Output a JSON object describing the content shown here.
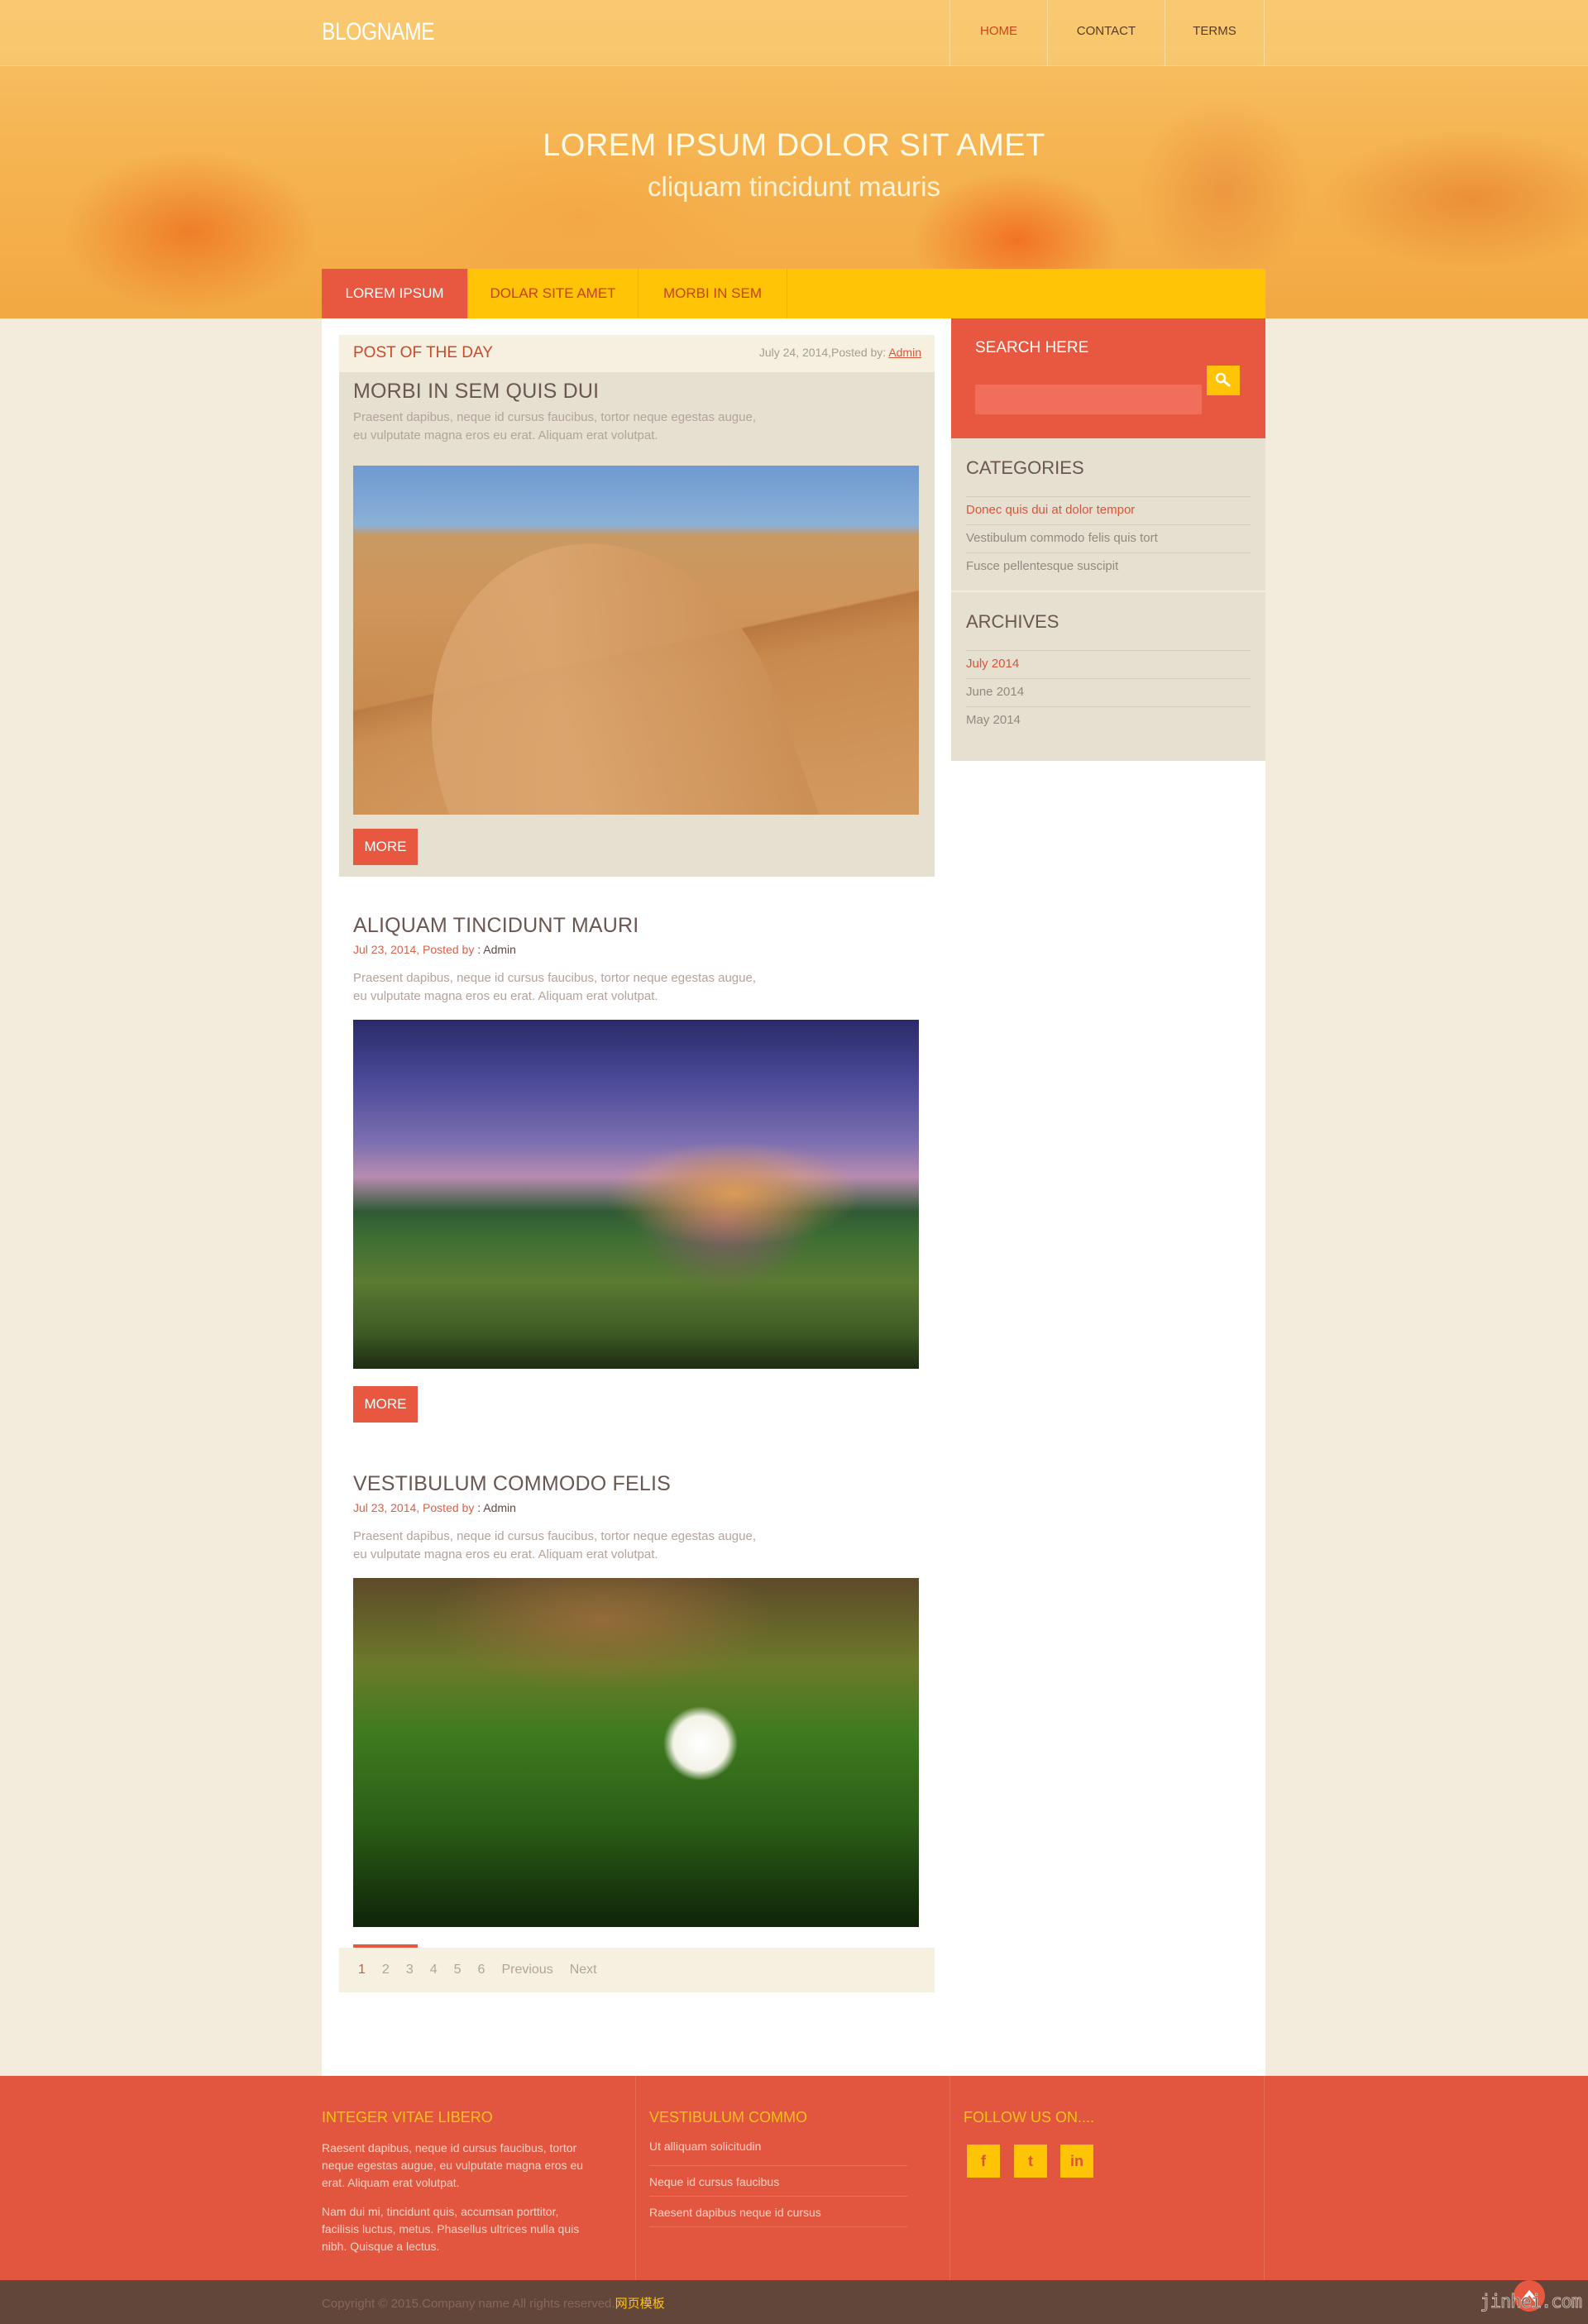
{
  "header": {
    "logo": "BLOGNAME",
    "nav": [
      {
        "label": "HOME",
        "active": true
      },
      {
        "label": "CONTACT",
        "active": false
      },
      {
        "label": "TERMS",
        "active": false
      }
    ]
  },
  "hero": {
    "title": "LOREM IPSUM DOLOR SIT AMET",
    "subtitle": "cliquam tincidunt mauris"
  },
  "subnav": [
    {
      "label": "LOREM IPSUM",
      "active": true
    },
    {
      "label": "DOLAR SITE AMET",
      "active": false
    },
    {
      "label": "MORBI IN SEM",
      "active": false
    }
  ],
  "featured": {
    "label": "POST OF THE DAY",
    "meta_prefix": "July 24, 2014,Posted by: ",
    "author": "Admin",
    "title": "MORBI IN SEM QUIS DUI",
    "excerpt_line1": "Praesent dapibus, neque id cursus faucibus, tortor neque egestas augue,",
    "excerpt_line2": "eu vulputate magna eros eu erat. Aliquam erat volutpat.",
    "image": "desert-dunes-image",
    "more_label": "MORE"
  },
  "posts": [
    {
      "title": "ALIQUAM TINCIDUNT MAURI",
      "meta_prefix": "Jul 23, 2014, Posted by",
      "meta_sep": " : ",
      "author": "Admin",
      "excerpt_line1": "Praesent dapibus, neque id cursus faucibus, tortor neque egestas augue,",
      "excerpt_line2": "eu vulputate magna eros eu erat. Aliquam erat volutpat.",
      "image": "mountain-meadow-image",
      "more_label": "MORE"
    },
    {
      "title": "VESTIBULUM COMMODO FELIS",
      "meta_prefix": "Jul 23, 2014, Posted by",
      "meta_sep": " : ",
      "author": "Admin",
      "excerpt_line1": "Praesent dapibus, neque id cursus faucibus, tortor neque egestas augue,",
      "excerpt_line2": "eu vulputate magna eros eu erat. Aliquam erat volutpat.",
      "image": "white-flower-image",
      "more_label": "MORE"
    }
  ],
  "pagination": {
    "pages": [
      "1",
      "2",
      "3",
      "4",
      "5",
      "6"
    ],
    "current": "1",
    "previous": "Previous",
    "next": "Next"
  },
  "sidebar": {
    "search": {
      "title": "SEARCH HERE",
      "placeholder": "",
      "value": ""
    },
    "categories": {
      "title": "CATEGORIES",
      "items": [
        {
          "label": "Donec quis dui at dolor tempor",
          "active": true
        },
        {
          "label": "Vestibulum commodo felis quis tort",
          "active": false
        },
        {
          "label": "Fusce pellentesque suscipit",
          "active": false
        }
      ]
    },
    "archives": {
      "title": "ARCHIVES",
      "items": [
        {
          "label": "July 2014",
          "active": true
        },
        {
          "label": "June 2014",
          "active": false
        },
        {
          "label": "May 2014",
          "active": false
        }
      ]
    }
  },
  "footer": {
    "col1": {
      "title": "INTEGER VITAE LIBERO",
      "p1": "Raesent dapibus, neque id cursus faucibus, tortor neque egestas augue, eu vulputate magna eros eu erat. Aliquam erat volutpat.",
      "p2": "Nam dui mi, tincidunt quis, accumsan porttitor, facilisis luctus, metus. Phasellus ultrices nulla quis nibh. Quisque a lectus."
    },
    "col2": {
      "title": "VESTIBULUM COMMO",
      "links": [
        "Ut alliquam solicitudin",
        "Neque id cursus faucibus",
        "Raesent dapibus neque id cursus"
      ]
    },
    "col3": {
      "title": "FOLLOW US ON....",
      "social": [
        {
          "icon": "facebook-icon",
          "glyph": "f"
        },
        {
          "icon": "twitter-icon",
          "glyph": "t"
        },
        {
          "icon": "linkedin-icon",
          "glyph": "in"
        }
      ]
    }
  },
  "copyright": {
    "text": "Copyright © 2015.Company name All rights reserved.",
    "link": "网页模板",
    "watermark": "jinhei.com"
  },
  "colors": {
    "accent_red": "#e8573f",
    "accent_yellow": "#ffc405",
    "footer_bg": "#e2553f",
    "copyright_bg": "#63463a",
    "panel_bg": "#e6e0d0",
    "page_bg": "#f3ecdc"
  }
}
